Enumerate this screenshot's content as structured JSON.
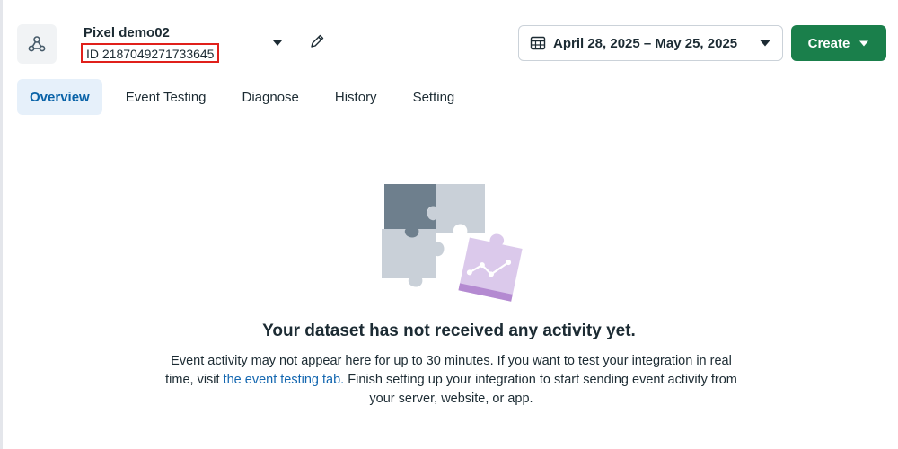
{
  "dataset": {
    "name": "Pixel demo02",
    "id_label": "ID 2187049271733645"
  },
  "date_picker": {
    "label": "April 28, 2025 – May 25, 2025"
  },
  "create_button": {
    "label": "Create"
  },
  "tabs": [
    {
      "label": "Overview",
      "active": true
    },
    {
      "label": "Event Testing",
      "active": false
    },
    {
      "label": "Diagnose",
      "active": false
    },
    {
      "label": "History",
      "active": false
    },
    {
      "label": "Setting",
      "active": false
    }
  ],
  "empty_state": {
    "title": "Your dataset has not received any activity yet.",
    "desc_part1": "Event activity may not appear here for up to 30 minutes. If you want to test your integration in real time, visit ",
    "link_text": "the event testing tab.",
    "desc_part2": " Finish setting up your integration to start sending event activity from your server, website, or app."
  },
  "colors": {
    "accent_green": "#1a7f4b",
    "active_tab_bg": "#e6f0fa",
    "active_tab_text": "#0a63a8",
    "link": "#1467b0",
    "highlight_box": "#e0201b"
  },
  "icons": {
    "dataset": "dataset-nodes-icon",
    "dropdown": "caret-down-icon",
    "edit": "pencil-icon",
    "calendar": "calendar-icon",
    "create_caret": "caret-down-icon"
  }
}
